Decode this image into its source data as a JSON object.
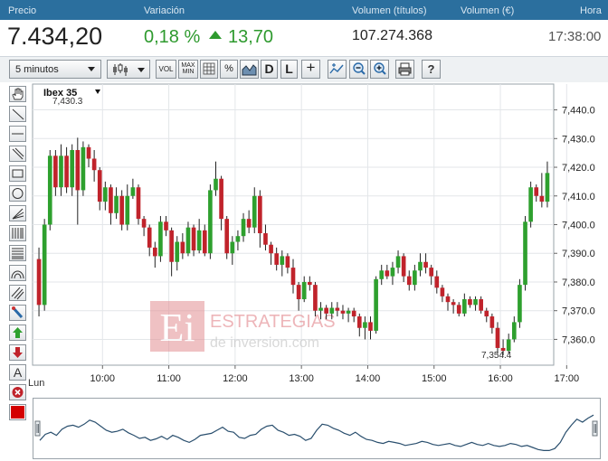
{
  "header": {
    "precio": "Precio",
    "variacion": "Variación",
    "volumen_titulos": "Volumen (títulos)",
    "volumen_eur": "Volumen (€)",
    "hora": "Hora"
  },
  "quote": {
    "price": "7.434,20",
    "change_pct": "0,18 %",
    "change_abs": "13,70",
    "volume": "107.274.368",
    "time": "17:38:00"
  },
  "toolbar": {
    "interval": "5 minutos",
    "buttons": [
      "VOL",
      "MAX MIN",
      "%",
      "D",
      "L",
      "+"
    ]
  },
  "colors": {
    "up": "#2ea02e",
    "down": "#c0232b",
    "header_bg": "#2b6f9e",
    "change_green": "#2e9a2e"
  },
  "icons": [
    "pan-hand-icon",
    "line-icon",
    "horizontal-line-icon",
    "parallel-lines-icon",
    "rectangle-icon",
    "circle-icon",
    "fan-icon",
    "fibonacci-vertical-icon",
    "fibonacci-horizontal-icon",
    "arc-icon",
    "channel-icon",
    "magnet-icon",
    "buy-arrow-icon",
    "sell-arrow-icon",
    "text-icon",
    "delete-icon",
    "color-swatch-icon"
  ],
  "watermark": {
    "mark": "Ei",
    "line1": "ESTRATEGIAS",
    "line2": "de inversion.com"
  },
  "chart_data": {
    "type": "candlestick",
    "title": "Ibex 35",
    "day_label": "Lun",
    "x_ticks": [
      "10:00",
      "11:00",
      "12:00",
      "13:00",
      "14:00",
      "15:00",
      "16:00",
      "17:00"
    ],
    "y_ticks": [
      7360,
      7370,
      7380,
      7390,
      7400,
      7410,
      7420,
      7430,
      7440
    ],
    "y_tick_labels": [
      "7,360.0",
      "7,370.0",
      "7,380.0",
      "7,390.0",
      "7,400.0",
      "7,410.0",
      "7,420.0",
      "7,430.0",
      "7,440.0"
    ],
    "ylim": [
      7351,
      7449
    ],
    "high_label": "7,430.3",
    "low_label": "7,354.4",
    "grid": true,
    "ohlc": [
      [
        7388,
        7392,
        7368,
        7372
      ],
      [
        7372,
        7402,
        7370,
        7400
      ],
      [
        7400,
        7426,
        7398,
        7424
      ],
      [
        7424,
        7426,
        7410,
        7413
      ],
      [
        7413,
        7428,
        7410,
        7424
      ],
      [
        7424,
        7427,
        7411,
        7413
      ],
      [
        7413,
        7428,
        7410,
        7426
      ],
      [
        7426,
        7430.3,
        7400,
        7412
      ],
      [
        7412,
        7429,
        7410,
        7427
      ],
      [
        7427,
        7428,
        7420,
        7423
      ],
      [
        7423,
        7426,
        7415,
        7419
      ],
      [
        7419,
        7420,
        7405,
        7408
      ],
      [
        7408,
        7415,
        7405,
        7413
      ],
      [
        7413,
        7414,
        7400,
        7404
      ],
      [
        7404,
        7413,
        7402,
        7410
      ],
      [
        7410,
        7412,
        7398,
        7400
      ],
      [
        7400,
        7414,
        7398,
        7410
      ],
      [
        7410,
        7416,
        7409,
        7413
      ],
      [
        7413,
        7414,
        7400,
        7402
      ],
      [
        7402,
        7403,
        7396,
        7399
      ],
      [
        7399,
        7400,
        7389,
        7392
      ],
      [
        7392,
        7394,
        7385,
        7389
      ],
      [
        7389,
        7403,
        7387,
        7401
      ],
      [
        7401,
        7403,
        7396,
        7398
      ],
      [
        7398,
        7399,
        7382,
        7387
      ],
      [
        7387,
        7396,
        7384,
        7394
      ],
      [
        7394,
        7397,
        7388,
        7390
      ],
      [
        7390,
        7401,
        7389,
        7399
      ],
      [
        7399,
        7400,
        7389,
        7391
      ],
      [
        7391,
        7402,
        7390,
        7398
      ],
      [
        7398,
        7400,
        7389,
        7390
      ],
      [
        7390,
        7414,
        7388,
        7412
      ],
      [
        7412,
        7422,
        7410,
        7416
      ],
      [
        7416,
        7417,
        7398,
        7402
      ],
      [
        7402,
        7403,
        7388,
        7390
      ],
      [
        7390,
        7396,
        7386,
        7394
      ],
      [
        7394,
        7398,
        7391,
        7396
      ],
      [
        7396,
        7404,
        7394,
        7402
      ],
      [
        7402,
        7405,
        7397,
        7399
      ],
      [
        7399,
        7413,
        7397,
        7410
      ],
      [
        7410,
        7412,
        7392,
        7397
      ],
      [
        7397,
        7400,
        7391,
        7393
      ],
      [
        7393,
        7394,
        7386,
        7390
      ],
      [
        7390,
        7392,
        7384,
        7386
      ],
      [
        7386,
        7391,
        7382,
        7389
      ],
      [
        7389,
        7390,
        7383,
        7385
      ],
      [
        7385,
        7388,
        7376,
        7379
      ],
      [
        7379,
        7380,
        7370,
        7374
      ],
      [
        7374,
        7382,
        7373,
        7380
      ],
      [
        7380,
        7382,
        7377,
        7379
      ],
      [
        7379,
        7380,
        7368,
        7370
      ],
      [
        7370,
        7373,
        7367,
        7371
      ],
      [
        7371,
        7372,
        7367,
        7369
      ],
      [
        7369,
        7373,
        7367,
        7371
      ],
      [
        7371,
        7373,
        7368,
        7370
      ],
      [
        7370,
        7372,
        7367,
        7369
      ],
      [
        7369,
        7371,
        7366,
        7370
      ],
      [
        7370,
        7371,
        7366,
        7368
      ],
      [
        7368,
        7369,
        7361,
        7364
      ],
      [
        7364,
        7368,
        7360,
        7366
      ],
      [
        7366,
        7368,
        7360,
        7363
      ],
      [
        7363,
        7382,
        7362,
        7381
      ],
      [
        7381,
        7386,
        7379,
        7384
      ],
      [
        7384,
        7386,
        7381,
        7382
      ],
      [
        7382,
        7387,
        7379,
        7385
      ],
      [
        7385,
        7391,
        7383,
        7389
      ],
      [
        7389,
        7390,
        7380,
        7382
      ],
      [
        7382,
        7384,
        7377,
        7379
      ],
      [
        7379,
        7386,
        7377,
        7384
      ],
      [
        7384,
        7390,
        7382,
        7387
      ],
      [
        7387,
        7390,
        7383,
        7385
      ],
      [
        7385,
        7386,
        7379,
        7382
      ],
      [
        7382,
        7384,
        7376,
        7378
      ],
      [
        7378,
        7379,
        7373,
        7375
      ],
      [
        7375,
        7376,
        7370,
        7373
      ],
      [
        7373,
        7374,
        7369,
        7372
      ],
      [
        7372,
        7373,
        7368,
        7369
      ],
      [
        7369,
        7376,
        7368,
        7374
      ],
      [
        7374,
        7375,
        7371,
        7372
      ],
      [
        7372,
        7375,
        7370,
        7374
      ],
      [
        7374,
        7375,
        7369,
        7370
      ],
      [
        7370,
        7371,
        7366,
        7368
      ],
      [
        7368,
        7369,
        7362,
        7364
      ],
      [
        7364,
        7366,
        7355,
        7357
      ],
      [
        7357,
        7360,
        7354.4,
        7356
      ],
      [
        7356,
        7362,
        7355,
        7360
      ],
      [
        7360,
        7368,
        7359,
        7366
      ],
      [
        7366,
        7381,
        7364,
        7379
      ],
      [
        7379,
        7403,
        7377,
        7401
      ],
      [
        7401,
        7415,
        7399,
        7413
      ],
      [
        7413,
        7414,
        7408,
        7410
      ],
      [
        7410,
        7418,
        7406,
        7408
      ],
      [
        7408,
        7422,
        7406,
        7418
      ]
    ],
    "volume_trend": [
      0.3,
      0.42,
      0.46,
      0.4,
      0.52,
      0.58,
      0.6,
      0.56,
      0.62,
      0.7,
      0.66,
      0.58,
      0.5,
      0.46,
      0.48,
      0.52,
      0.45,
      0.4,
      0.34,
      0.36,
      0.3,
      0.33,
      0.38,
      0.32,
      0.4,
      0.36,
      0.3,
      0.26,
      0.32,
      0.4,
      0.42,
      0.44,
      0.5,
      0.56,
      0.48,
      0.46,
      0.36,
      0.34,
      0.4,
      0.42,
      0.52,
      0.58,
      0.6,
      0.5,
      0.46,
      0.4,
      0.42,
      0.38,
      0.3,
      0.34,
      0.5,
      0.62,
      0.6,
      0.54,
      0.5,
      0.44,
      0.4,
      0.46,
      0.38,
      0.32,
      0.3,
      0.26,
      0.24,
      0.28,
      0.26,
      0.24,
      0.2,
      0.22,
      0.24,
      0.28,
      0.26,
      0.22,
      0.2,
      0.22,
      0.24,
      0.2,
      0.18,
      0.22,
      0.26,
      0.22,
      0.2,
      0.24,
      0.2,
      0.18,
      0.2,
      0.24,
      0.22,
      0.18,
      0.2,
      0.16,
      0.12,
      0.1,
      0.1,
      0.14,
      0.26,
      0.46,
      0.6,
      0.72,
      0.66,
      0.74,
      0.8
    ]
  }
}
